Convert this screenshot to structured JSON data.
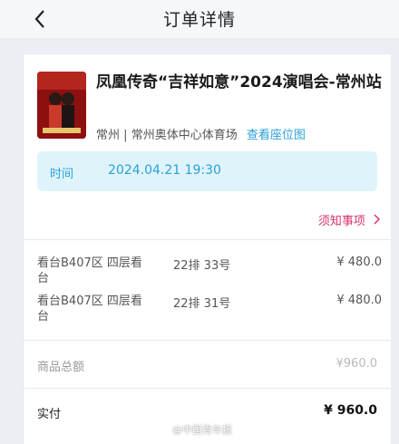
{
  "nav": {
    "title": "订单详情",
    "back_icon": "chevron-left-icon"
  },
  "event": {
    "title": "凤凰传奇“吉祥如意”2024演唱会-常州站",
    "city": "常州",
    "separator": "|",
    "venue": "常州奥体中心体育场",
    "seat_map_link": "查看座位图",
    "poster_color": "#7a0d0d"
  },
  "time": {
    "label": "时间",
    "value": "2024.04.21 19:30",
    "accent": "#2aa1d8"
  },
  "notice": {
    "label": "须知事项",
    "icon": "chevron-right-icon",
    "color": "#d6336c"
  },
  "tickets": [
    {
      "area": "看台B407区 四层看台",
      "seat": "22排 33号",
      "price": "¥ 480.0"
    },
    {
      "area": "看台B407区 四层看台",
      "seat": "22排 31号",
      "price": "¥ 480.0"
    }
  ],
  "summary": {
    "total_label": "商品总额",
    "total_value": "¥960.0"
  },
  "paid": {
    "label": "实付",
    "value": "¥ 960.0"
  },
  "watermark": "@中国青年报"
}
